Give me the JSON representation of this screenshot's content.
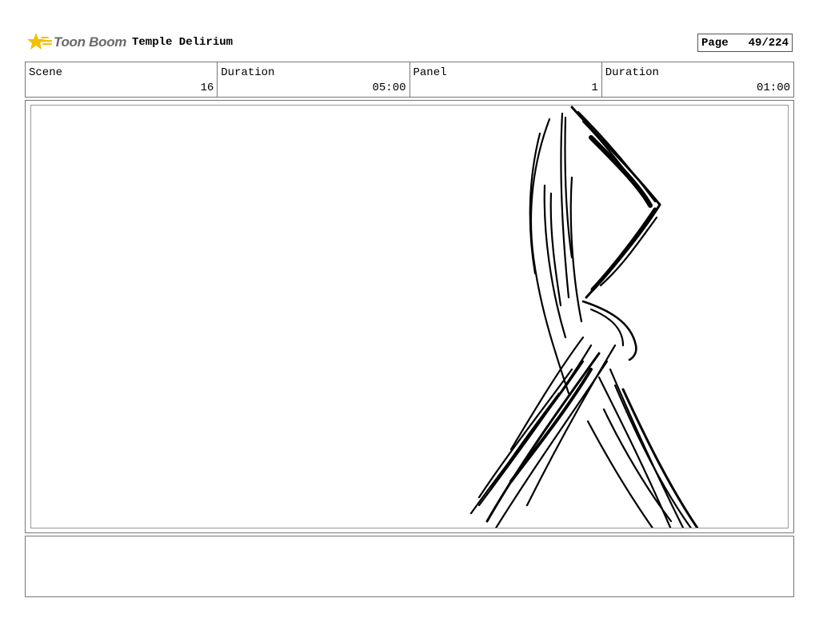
{
  "header": {
    "logo_text": "Toon Boom",
    "project_title": "Temple Delirium",
    "page_label": "Page",
    "page_number": "49/224"
  },
  "info": {
    "scene_label": "Scene",
    "scene_value": "16",
    "scene_duration_label": "Duration",
    "scene_duration_value": "05:00",
    "panel_label": "Panel",
    "panel_value": "1",
    "panel_duration_label": "Duration",
    "panel_duration_value": "01:00"
  },
  "panel": {
    "sketch": "rough-figure-legs-sketch"
  },
  "notes": {
    "text": ""
  },
  "colors": {
    "logo_star": "#f5c000",
    "logo_text": "#6a6a6a",
    "border": "#777777"
  }
}
